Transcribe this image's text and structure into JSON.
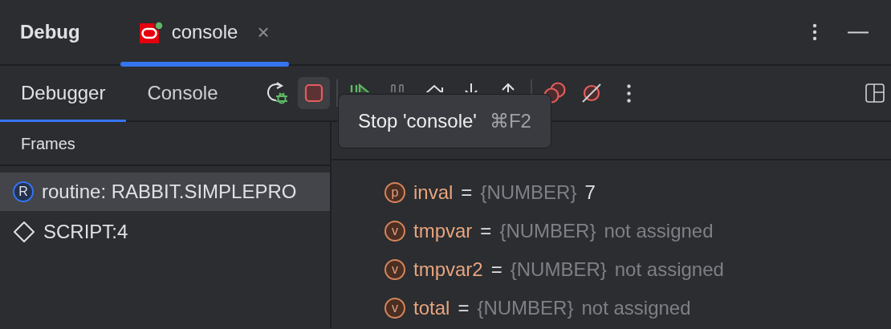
{
  "window": {
    "title": "Debug"
  },
  "session_tabs": [
    {
      "label": "console",
      "selected": true,
      "running": true,
      "close": "×"
    }
  ],
  "view_tabs": [
    {
      "label": "Debugger",
      "selected": true
    },
    {
      "label": "Console",
      "selected": false
    }
  ],
  "toolbar": [
    {
      "kind": "rerun",
      "disabled": false,
      "hovered": false
    },
    {
      "kind": "stop",
      "disabled": false,
      "hovered": true
    },
    {
      "kind": "separator"
    },
    {
      "kind": "resume",
      "disabled": false,
      "hovered": false
    },
    {
      "kind": "pause",
      "disabled": true,
      "hovered": false
    },
    {
      "kind": "step_over",
      "disabled": false,
      "hovered": false
    },
    {
      "kind": "step_into",
      "disabled": false,
      "hovered": false
    },
    {
      "kind": "step_out",
      "disabled": false,
      "hovered": false
    },
    {
      "kind": "separator"
    },
    {
      "kind": "breakpoints",
      "disabled": false,
      "hovered": false
    },
    {
      "kind": "mute",
      "disabled": false,
      "hovered": false
    },
    {
      "kind": "more",
      "disabled": false,
      "hovered": false
    }
  ],
  "tooltip": {
    "text": "Stop 'console'",
    "shortcut": "⌘F2"
  },
  "frames": {
    "title": "Frames",
    "items": [
      {
        "label": "routine: RABBIT.SIMPLEPRO",
        "kind": "routine",
        "badge": "R",
        "selected": true
      },
      {
        "label": "SCRIPT:4",
        "kind": "script",
        "selected": false
      }
    ]
  },
  "variables": [
    {
      "badge": "p",
      "name": "inval",
      "operator": "=",
      "type": "{NUMBER}",
      "value": "7",
      "assigned": true
    },
    {
      "badge": "v",
      "name": "tmpvar",
      "operator": "=",
      "type": "{NUMBER}",
      "value": "not assigned",
      "assigned": false
    },
    {
      "badge": "v",
      "name": "tmpvar2",
      "operator": "=",
      "type": "{NUMBER}",
      "value": "not assigned",
      "assigned": false
    },
    {
      "badge": "v",
      "name": "total",
      "operator": "=",
      "type": "{NUMBER}",
      "value": "not assigned",
      "assigned": false
    }
  ]
}
